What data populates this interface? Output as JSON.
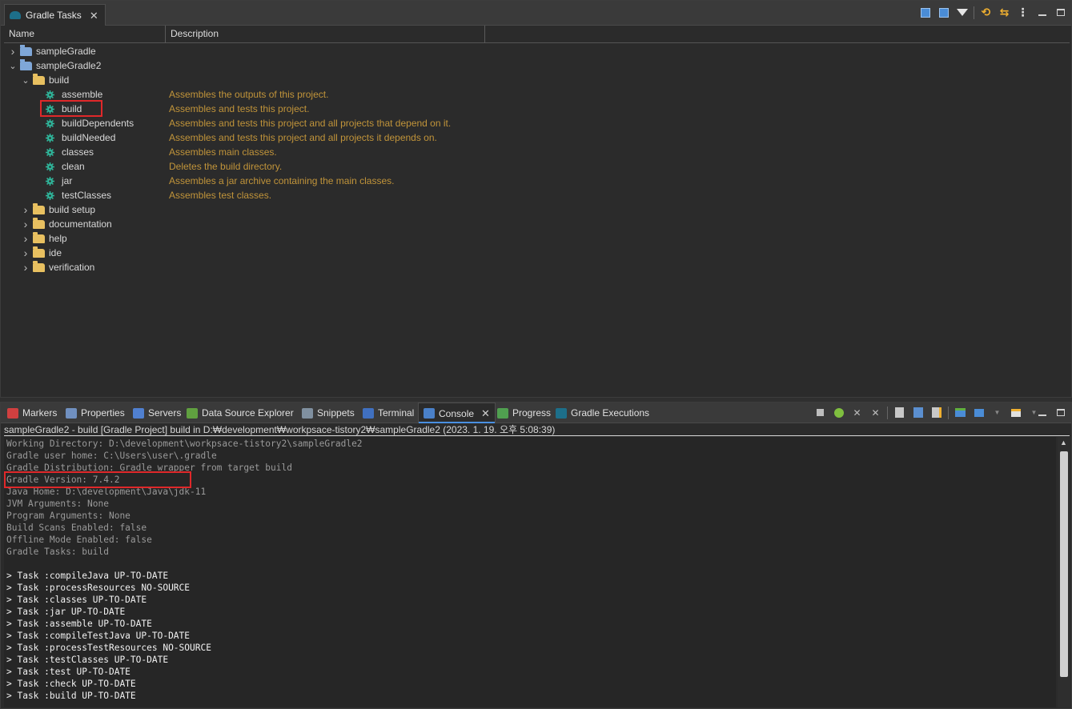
{
  "top_view": {
    "tab_title": "Gradle Tasks",
    "columns": [
      "Name",
      "Description"
    ],
    "tree": [
      {
        "label": "sampleGradle",
        "type": "project",
        "expanded": false,
        "level": 0,
        "description": ""
      },
      {
        "label": "sampleGradle2",
        "type": "project",
        "expanded": true,
        "level": 0,
        "description": ""
      },
      {
        "label": "build",
        "type": "folder",
        "expanded": true,
        "level": 1,
        "description": ""
      },
      {
        "label": "assemble",
        "type": "task",
        "level": 2,
        "description": "Assembles the outputs of this project."
      },
      {
        "label": "build",
        "type": "task",
        "level": 2,
        "description": "Assembles and tests this project.",
        "highlighted": true
      },
      {
        "label": "buildDependents",
        "type": "task",
        "level": 2,
        "description": "Assembles and tests this project and all projects that depend on it."
      },
      {
        "label": "buildNeeded",
        "type": "task",
        "level": 2,
        "description": "Assembles and tests this project and all projects it depends on."
      },
      {
        "label": "classes",
        "type": "task",
        "level": 2,
        "description": "Assembles main classes."
      },
      {
        "label": "clean",
        "type": "task",
        "level": 2,
        "description": "Deletes the build directory."
      },
      {
        "label": "jar",
        "type": "task",
        "level": 2,
        "description": "Assembles a jar archive containing the main classes."
      },
      {
        "label": "testClasses",
        "type": "task",
        "level": 2,
        "description": "Assembles test classes."
      },
      {
        "label": "build setup",
        "type": "folder",
        "expanded": false,
        "level": 1,
        "description": ""
      },
      {
        "label": "documentation",
        "type": "folder",
        "expanded": false,
        "level": 1,
        "description": ""
      },
      {
        "label": "help",
        "type": "folder",
        "expanded": false,
        "level": 1,
        "description": ""
      },
      {
        "label": "ide",
        "type": "folder",
        "expanded": false,
        "level": 1,
        "description": ""
      },
      {
        "label": "verification",
        "type": "folder",
        "expanded": false,
        "level": 1,
        "description": ""
      }
    ]
  },
  "bottom_view": {
    "tabs": [
      {
        "label": "Markers",
        "icon": "markers-icon",
        "color": "#d04040"
      },
      {
        "label": "Properties",
        "icon": "properties-icon",
        "color": "#7090c0"
      },
      {
        "label": "Servers",
        "icon": "servers-icon",
        "color": "#5080d0"
      },
      {
        "label": "Data Source Explorer",
        "icon": "data-source-icon",
        "color": "#60a040"
      },
      {
        "label": "Snippets",
        "icon": "snippets-icon",
        "color": "#8090a0"
      },
      {
        "label": "Terminal",
        "icon": "terminal-icon",
        "color": "#4070c0"
      },
      {
        "label": "Console",
        "icon": "console-icon",
        "color": "#4a80c8",
        "active": true
      },
      {
        "label": "Progress",
        "icon": "progress-icon",
        "color": "#50a050"
      },
      {
        "label": "Gradle Executions",
        "icon": "gradle-executions-icon",
        "color": "#1d6f8a"
      }
    ],
    "console_header": "sampleGradle2 - build [Gradle Project] build in D:₩development₩workpsace-tistory2₩sampleGradle2 (2023. 1. 19. 오후 5:08:39)",
    "console_lines": [
      {
        "text": "Working Directory: D:\\development\\workpsace-tistory2\\sampleGradle2",
        "style": "gray"
      },
      {
        "text": "Gradle user home: C:\\Users\\user\\.gradle",
        "style": "gray"
      },
      {
        "text": "Gradle Distribution: Gradle wrapper from target build",
        "style": "gray"
      },
      {
        "text": "Gradle Version: 7.4.2",
        "style": "gray",
        "highlighted": true
      },
      {
        "text": "Java Home: D:\\development\\Java\\jdk-11",
        "style": "gray"
      },
      {
        "text": "JVM Arguments: None",
        "style": "gray"
      },
      {
        "text": "Program Arguments: None",
        "style": "gray"
      },
      {
        "text": "Build Scans Enabled: false",
        "style": "gray"
      },
      {
        "text": "Offline Mode Enabled: false",
        "style": "gray"
      },
      {
        "text": "Gradle Tasks: build",
        "style": "gray"
      },
      {
        "text": "",
        "style": "gray"
      },
      {
        "text": "> Task :compileJava UP-TO-DATE",
        "style": "white"
      },
      {
        "text": "> Task :processResources NO-SOURCE",
        "style": "white"
      },
      {
        "text": "> Task :classes UP-TO-DATE",
        "style": "white"
      },
      {
        "text": "> Task :jar UP-TO-DATE",
        "style": "white"
      },
      {
        "text": "> Task :assemble UP-TO-DATE",
        "style": "white"
      },
      {
        "text": "> Task :compileTestJava UP-TO-DATE",
        "style": "white"
      },
      {
        "text": "> Task :processTestResources NO-SOURCE",
        "style": "white"
      },
      {
        "text": "> Task :testClasses UP-TO-DATE",
        "style": "white"
      },
      {
        "text": "> Task :test UP-TO-DATE",
        "style": "white"
      },
      {
        "text": "> Task :check UP-TO-DATE",
        "style": "white"
      },
      {
        "text": "> Task :build UP-TO-DATE",
        "style": "white"
      }
    ]
  },
  "colors": {
    "description_text": "#c1943a",
    "highlight_border": "#e0282a",
    "task_icon": "#2fb59a"
  }
}
